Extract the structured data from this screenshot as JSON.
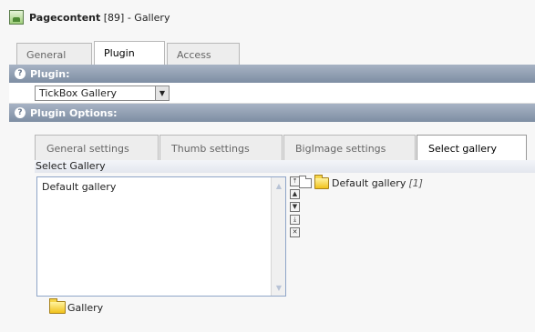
{
  "header": {
    "title_bold": "Pagecontent",
    "title_rest": "[89] - Gallery"
  },
  "tabs": [
    {
      "label": "General"
    },
    {
      "label": "Plugin"
    },
    {
      "label": "Access"
    }
  ],
  "sections": {
    "plugin": {
      "label": "Plugin:",
      "selected": "TickBox Gallery"
    },
    "plugin_options": {
      "label": "Plugin Options:"
    }
  },
  "subtabs": [
    {
      "label": "General settings"
    },
    {
      "label": "Thumb settings"
    },
    {
      "label": "BigImage settings"
    },
    {
      "label": "Select gallery"
    }
  ],
  "select_gallery": {
    "label": "Select Gallery",
    "options": [
      "Default gallery"
    ],
    "tree_item": {
      "label": "Default gallery",
      "count": "[1]"
    },
    "bottom_label": "Gallery"
  },
  "icons": [
    "page-icon",
    "help-icon",
    "folder-icon",
    "scroll-up-icon",
    "scroll-down-icon",
    "move-top-icon",
    "move-up-icon",
    "move-down-icon",
    "move-bottom-icon",
    "remove-icon"
  ]
}
